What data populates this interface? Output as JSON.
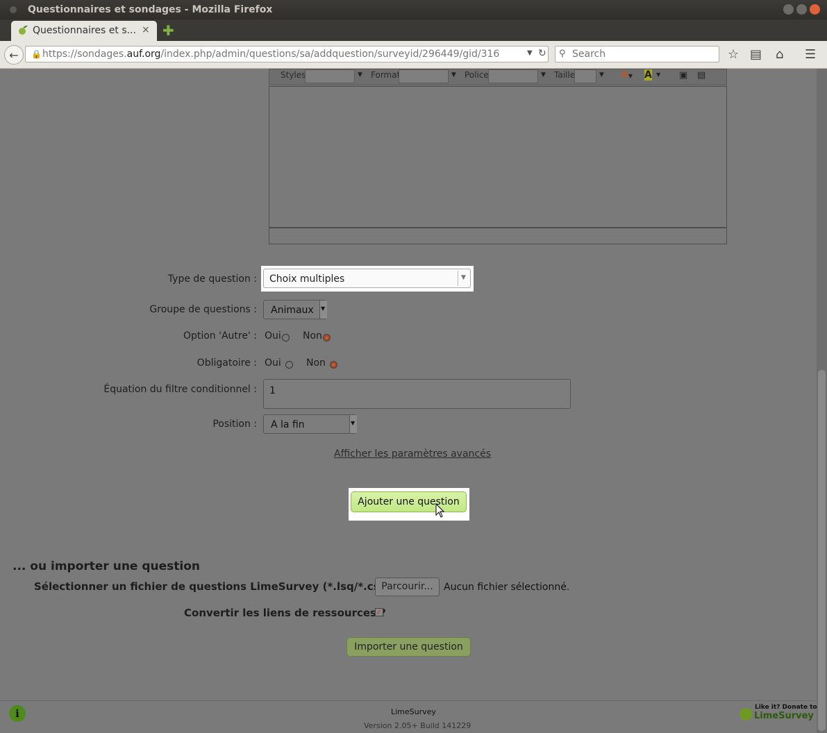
{
  "window": {
    "title": "Questionnaires et sondages - Mozilla Firefox"
  },
  "tab": {
    "label": "Questionnaires et s...",
    "close": "×",
    "new_tab": "✚"
  },
  "nav": {
    "url_prefix": "https://sondages.",
    "url_domain": "auf.org",
    "url_suffix": "/index.php/admin/questions/sa/addquestion/surveyid/296449/gid/316",
    "search_placeholder": "Search"
  },
  "editor_toolbar": {
    "styles": "Styles",
    "format": "Format",
    "police": "Police",
    "taille": "Taille"
  },
  "form": {
    "type_label": "Type de question :",
    "type_value": "Choix multiples",
    "group_label": "Groupe de questions :",
    "group_value": "Animaux",
    "other_label": "Option 'Autre' :",
    "other_yes": "Oui",
    "other_no": "Non",
    "other_selected": "Non",
    "mandatory_label": "Obligatoire :",
    "mandatory_yes": "Oui",
    "mandatory_no": "Non",
    "mandatory_selected": "Non",
    "equation_label": "Équation du filtre conditionnel :",
    "equation_value": "1",
    "position_label": "Position :",
    "position_value": "A la fin",
    "advanced_link": "Afficher les paramètres avancés",
    "add_button": "Ajouter une question"
  },
  "import": {
    "title": "... ou importer une question",
    "select_label": "Sélectionner un fichier de questions LimeSurvey (*.lsq/*.csv):",
    "browse_button": "Parcourir...",
    "no_file": "Aucun fichier sélectionné.",
    "convert_label": "Convertir les liens de ressources ?",
    "convert_checked": true,
    "import_button": "Importer une question"
  },
  "footer": {
    "app_name": "LimeSurvey",
    "version": "Version 2.05+ Build 141229",
    "donate_line1": "Like it? Donate to",
    "donate_line2": "LimeSurvey"
  },
  "colors": {
    "add_button": "#c8eb8c",
    "radio_selected": "#a44a26",
    "highlight": "#ffffff"
  }
}
